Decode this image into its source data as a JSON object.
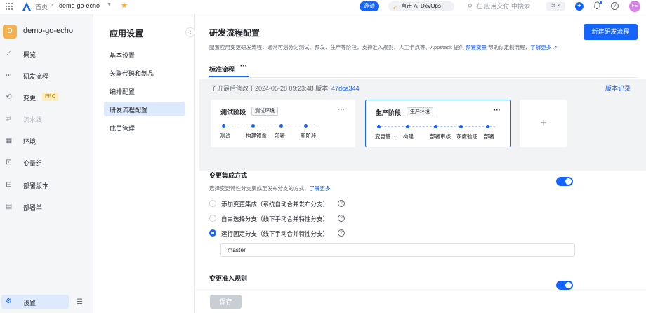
{
  "topbar": {
    "home": "首页",
    "separator": ">",
    "app_name": "demo-go-echo",
    "invite_label": "邀请",
    "ai_label": "直击 AI DevOps",
    "search_placeholder": "在 应用交付 中搜索",
    "shortcut": "⌘ K",
    "avatar_initials": "FE"
  },
  "sidebar": {
    "app_initial": "D",
    "app_name": "demo-go-echo",
    "items": [
      {
        "label": "概览",
        "icon": "chart-line-icon"
      },
      {
        "label": "研发流程",
        "icon": "infinity-icon"
      },
      {
        "label": "变更",
        "icon": "change-icon",
        "badge": "PRO"
      },
      {
        "label": "流水线",
        "icon": "pipeline-icon",
        "disabled": true
      },
      {
        "label": "环境",
        "icon": "grid-icon"
      },
      {
        "label": "变量组",
        "icon": "variable-icon"
      },
      {
        "label": "部署版本",
        "icon": "package-icon"
      },
      {
        "label": "部署单",
        "icon": "document-icon"
      }
    ],
    "settings_label": "设置"
  },
  "subnav": {
    "title": "应用设置",
    "items": [
      {
        "label": "基本设置"
      },
      {
        "label": "关联代码和制品"
      },
      {
        "label": "编排配置"
      },
      {
        "label": "研发流程配置",
        "active": true
      },
      {
        "label": "成员管理"
      }
    ]
  },
  "main": {
    "title": "研发流程配置",
    "desc": "配置应用变更研发流程，通常可划分为测试、预发、生产等阶段，支持准入规则、人工卡点等。Appstack 提供 ",
    "desc_link1": "预置变量",
    "desc_mid": " 帮助你定制流程，",
    "desc_link2": "了解更多",
    "new_button": "新建研发流程",
    "tab": "标准流程",
    "tab_more": "···",
    "modified_text": "子丑最后修改于2024-05-28 09:23:48   版本: ",
    "version": "47dca344",
    "history_link": "版本记录",
    "cards": [
      {
        "name": "测试阶段",
        "tag": "测试环境",
        "more": "···",
        "stages": [
          "测试",
          "构建镜像",
          "部署",
          "新阶段"
        ]
      },
      {
        "name": "生产阶段",
        "tag": "生产环境",
        "more": "···",
        "stages": [
          "变更管...",
          "构建",
          "部署审核",
          "灰度验证",
          "部署"
        ]
      }
    ],
    "add_card": "+",
    "integration": {
      "title": "变更集成方式",
      "desc": "选择变更特性分支集成至发布分支的方式，",
      "link": "了解更多",
      "options": [
        {
          "label": "添加变更集成（系统自动合并发布分支）",
          "selected": false
        },
        {
          "label": "自由选择分支（线下手动合并特性分支）",
          "selected": false
        },
        {
          "label": "运行固定分支（线下手动合并特性分支）",
          "selected": true
        }
      ],
      "branch_value": "master",
      "toggle_on": true
    },
    "admission": {
      "title": "变更准入规则",
      "toggle_on": true
    },
    "save_button": "保存"
  }
}
